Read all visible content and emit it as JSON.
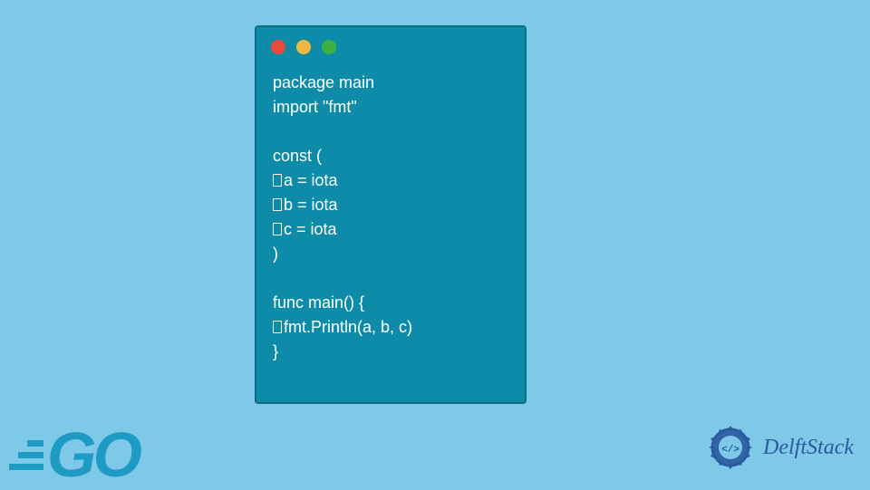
{
  "code": {
    "lines": [
      "package main",
      "import \"fmt\"",
      "",
      "const (",
      "\ta = iota",
      "\tb = iota",
      "\tc = iota",
      ")",
      "",
      "func main() {",
      "\tfmt.Println(a, b, c)",
      "}"
    ]
  },
  "branding": {
    "go_text": "GO",
    "delft_text": "DelftStack"
  }
}
